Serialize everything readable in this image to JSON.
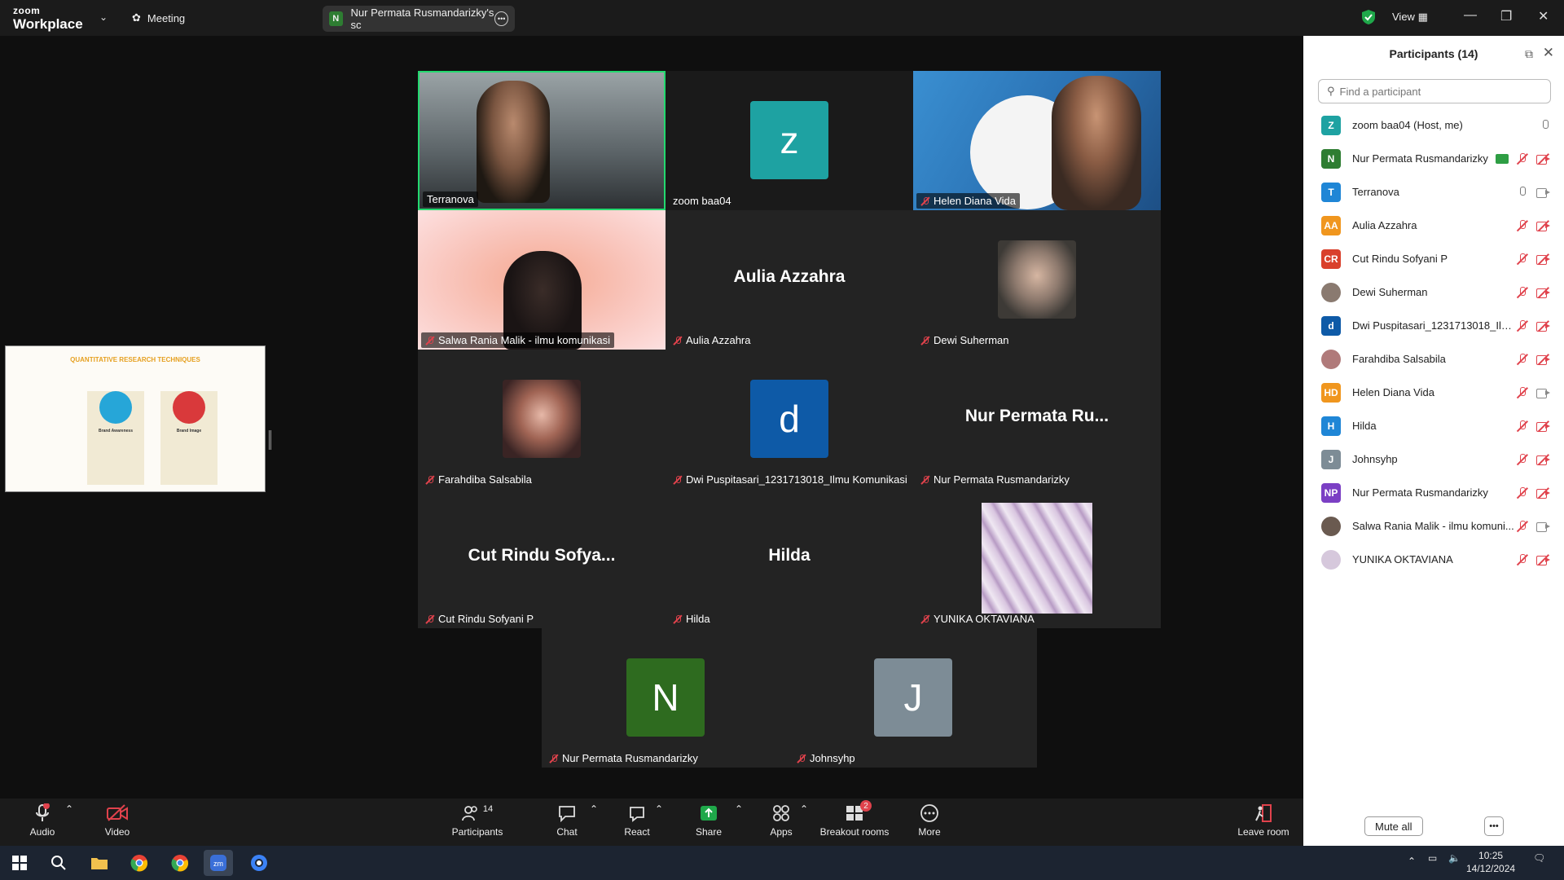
{
  "titlebar": {
    "logo_top": "zoom",
    "logo_bottom": "Workplace",
    "meeting_label": "Meeting",
    "share_title": "Nur Permata Rusmandarizky's sc",
    "share_initial": "N",
    "view_label": "View"
  },
  "tiles": [
    {
      "name": "Terranova",
      "muted": false
    },
    {
      "name": "zoom baa04",
      "initial": "z",
      "muted": false
    },
    {
      "name": "Helen Diana Vida",
      "muted": true
    },
    {
      "name": "Salwa Rania Malik - ilmu komunikasi",
      "muted": true
    },
    {
      "name": "Aulia Azzahra",
      "display": "Aulia Azzahra",
      "muted": true
    },
    {
      "name": "Dewi Suherman",
      "muted": true
    },
    {
      "name": "Farahdiba Salsabila",
      "muted": true
    },
    {
      "name": "Dwi Puspitasari_1231713018_Ilmu Komunikasi",
      "initial": "d",
      "muted": true
    },
    {
      "name": "Nur Permata Rusmandarizky",
      "display": "Nur Permata Ru...",
      "muted": true
    },
    {
      "name": "Cut Rindu Sofyani P",
      "display": "Cut Rindu Sofya...",
      "muted": true
    },
    {
      "name": "Hilda",
      "display": "Hilda",
      "muted": true
    },
    {
      "name": "YUNIKA OKTAVIANA",
      "muted": true
    },
    {
      "name": "Nur Permata Rusmandarizky",
      "initial": "N",
      "muted": true
    },
    {
      "name": "Johnsyhp",
      "initial": "J",
      "muted": true
    }
  ],
  "slide": {
    "title": "QUANTITATIVE RESEARCH TECHNIQUES",
    "card1": "Brand Awareness",
    "card2": "Brand Image"
  },
  "panel": {
    "title": "Participants (14)",
    "search_placeholder": "Find a participant",
    "mute_all": "Mute all",
    "participants": [
      {
        "initials": "Z",
        "name": "zoom baa04 (Host, me)",
        "color": "#1ea2a2",
        "mic": "on",
        "cam": "none",
        "share": false
      },
      {
        "initials": "N",
        "name": "Nur Permata Rusmandarizky",
        "color": "#2e7d32",
        "mic": "muted",
        "cam": "off",
        "share": true
      },
      {
        "initials": "T",
        "name": "Terranova",
        "color": "#1f86d6",
        "mic": "on",
        "cam": "on",
        "share": false
      },
      {
        "initials": "AA",
        "name": "Aulia Azzahra",
        "color": "#f0961e",
        "mic": "muted",
        "cam": "off",
        "share": false
      },
      {
        "initials": "CR",
        "name": "Cut Rindu Sofyani P",
        "color": "#d9402c",
        "mic": "muted",
        "cam": "off",
        "share": false
      },
      {
        "initials": "",
        "name": "Dewi Suherman",
        "color": "#8a7a70",
        "mic": "muted",
        "cam": "off",
        "share": false
      },
      {
        "initials": "d",
        "name": "Dwi Puspitasari_1231713018_Ilm...",
        "color": "#0e5aa7",
        "mic": "muted",
        "cam": "off",
        "share": false
      },
      {
        "initials": "",
        "name": "Farahdiba Salsabila",
        "color": "#b07a7a",
        "mic": "muted",
        "cam": "off",
        "share": false
      },
      {
        "initials": "HD",
        "name": "Helen Diana Vida",
        "color": "#f0961e",
        "mic": "muted",
        "cam": "on",
        "share": false
      },
      {
        "initials": "H",
        "name": "Hilda",
        "color": "#1f86d6",
        "mic": "muted",
        "cam": "off",
        "share": false
      },
      {
        "initials": "J",
        "name": "Johnsyhp",
        "color": "#7d8c96",
        "mic": "muted",
        "cam": "off",
        "share": false
      },
      {
        "initials": "NP",
        "name": "Nur Permata Rusmandarizky",
        "color": "#7b3fc4",
        "mic": "muted",
        "cam": "off",
        "share": false
      },
      {
        "initials": "",
        "name": "Salwa Rania Malik - ilmu komuni...",
        "color": "#6a5a50",
        "mic": "muted",
        "cam": "on",
        "share": false
      },
      {
        "initials": "",
        "name": "YUNIKA OKTAVIANA",
        "color": "#d6c8dc",
        "mic": "muted",
        "cam": "off",
        "share": false
      }
    ]
  },
  "toolbar": {
    "audio": "Audio",
    "video": "Video",
    "participants": "Participants",
    "participants_count": "14",
    "chat": "Chat",
    "react": "React",
    "share": "Share",
    "apps": "Apps",
    "breakout": "Breakout rooms",
    "breakout_badge": "2",
    "more": "More",
    "leave": "Leave room"
  },
  "taskbar": {
    "time": "10:25",
    "date": "14/12/2024"
  }
}
